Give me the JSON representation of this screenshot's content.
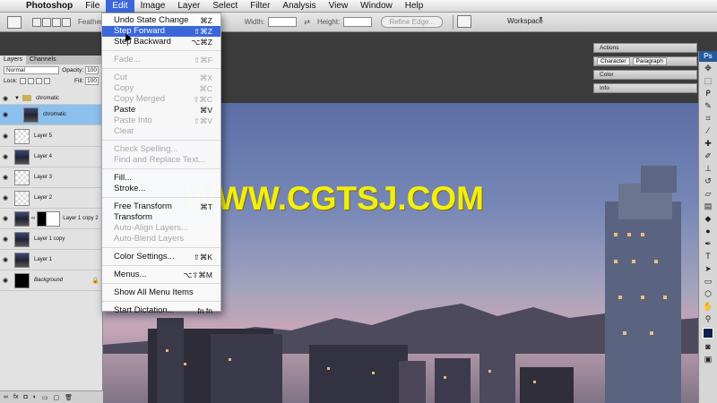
{
  "menubar": {
    "apple_icon": "apple-icon",
    "items": [
      "Photoshop",
      "File",
      "Edit",
      "Image",
      "Layer",
      "Select",
      "Filter",
      "Analysis",
      "View",
      "Window",
      "Help"
    ]
  },
  "optbar": {
    "feather_label": "Feather",
    "width_label": "Width:",
    "height_label": "Height:",
    "refine_label": "Refine Edge...",
    "workspace_label": "Workspace"
  },
  "edit_menu": {
    "undo": {
      "label": "Undo State Change",
      "shortcut": "⌘Z"
    },
    "step_forward": {
      "label": "Step Forward",
      "shortcut": "⇧⌘Z"
    },
    "step_backward": {
      "label": "Step Backward",
      "shortcut": "⌥⌘Z"
    },
    "fade": {
      "label": "Fade...",
      "shortcut": "⇧⌘F"
    },
    "cut": {
      "label": "Cut",
      "shortcut": "⌘X"
    },
    "copy": {
      "label": "Copy",
      "shortcut": "⌘C"
    },
    "copy_merged": {
      "label": "Copy Merged",
      "shortcut": "⇧⌘C"
    },
    "paste": {
      "label": "Paste",
      "shortcut": "⌘V"
    },
    "paste_into": {
      "label": "Paste Into",
      "shortcut": "⇧⌘V"
    },
    "clear": {
      "label": "Clear"
    },
    "check_spelling": {
      "label": "Check Spelling..."
    },
    "find_replace": {
      "label": "Find and Replace Text..."
    },
    "fill": {
      "label": "Fill..."
    },
    "stroke": {
      "label": "Stroke..."
    },
    "free_transform": {
      "label": "Free Transform",
      "shortcut": "⌘T"
    },
    "transform": {
      "label": "Transform"
    },
    "auto_align": {
      "label": "Auto-Align Layers..."
    },
    "auto_blend": {
      "label": "Auto-Blend Layers"
    },
    "color_settings": {
      "label": "Color Settings...",
      "shortcut": "⇧⌘K"
    },
    "menus": {
      "label": "Menus...",
      "shortcut": "⌥⇧⌘M"
    },
    "show_all": {
      "label": "Show All Menu Items"
    },
    "dictation": {
      "label": "Start Dictation...",
      "shortcut": "fn fn"
    }
  },
  "layers_panel": {
    "tabs": [
      "Layers",
      "Channels"
    ],
    "blend_mode": "Normal",
    "opacity_label": "Opacity:",
    "opacity_value": "100",
    "lock_label": "Lock:",
    "fill_label": "Fill:",
    "fill_value": "100",
    "layers": [
      {
        "name": "chromatic",
        "kind": "group"
      },
      {
        "name": "chromatic",
        "kind": "city",
        "selected": true
      },
      {
        "name": "Layer 5",
        "kind": "checker"
      },
      {
        "name": "Layer 4",
        "kind": "city"
      },
      {
        "name": "Layer 3",
        "kind": "checker"
      },
      {
        "name": "Layer 2",
        "kind": "checker"
      },
      {
        "name": "Layer 1 copy 2",
        "kind": "city"
      },
      {
        "name": "Layer 1 copy",
        "kind": "city"
      },
      {
        "name": "Layer 1",
        "kind": "city"
      },
      {
        "name": "Background",
        "kind": "black"
      }
    ]
  },
  "dock": {
    "actions": "Actions",
    "character": "Character",
    "paragraph": "Paragraph",
    "color": "Color",
    "info": "Info"
  },
  "toolbox": {
    "logo": "Ps",
    "tools": [
      "move-icon",
      "marquee-icon",
      "lasso-icon",
      "quick-select-icon",
      "crop-icon",
      "eyedropper-icon",
      "healing-icon",
      "brush-icon",
      "stamp-icon",
      "history-brush-icon",
      "eraser-icon",
      "gradient-icon",
      "blur-icon",
      "dodge-icon",
      "pen-icon",
      "type-icon",
      "path-select-icon",
      "shape-icon",
      "3d-icon",
      "hand-icon",
      "zoom-icon"
    ],
    "foreground_color": "#10214d"
  },
  "canvas": {
    "watermark": "WWW.CGTSJ.COM"
  },
  "colors": {
    "menu_highlight": "#3a67d9",
    "watermark": "#f2ee10"
  }
}
